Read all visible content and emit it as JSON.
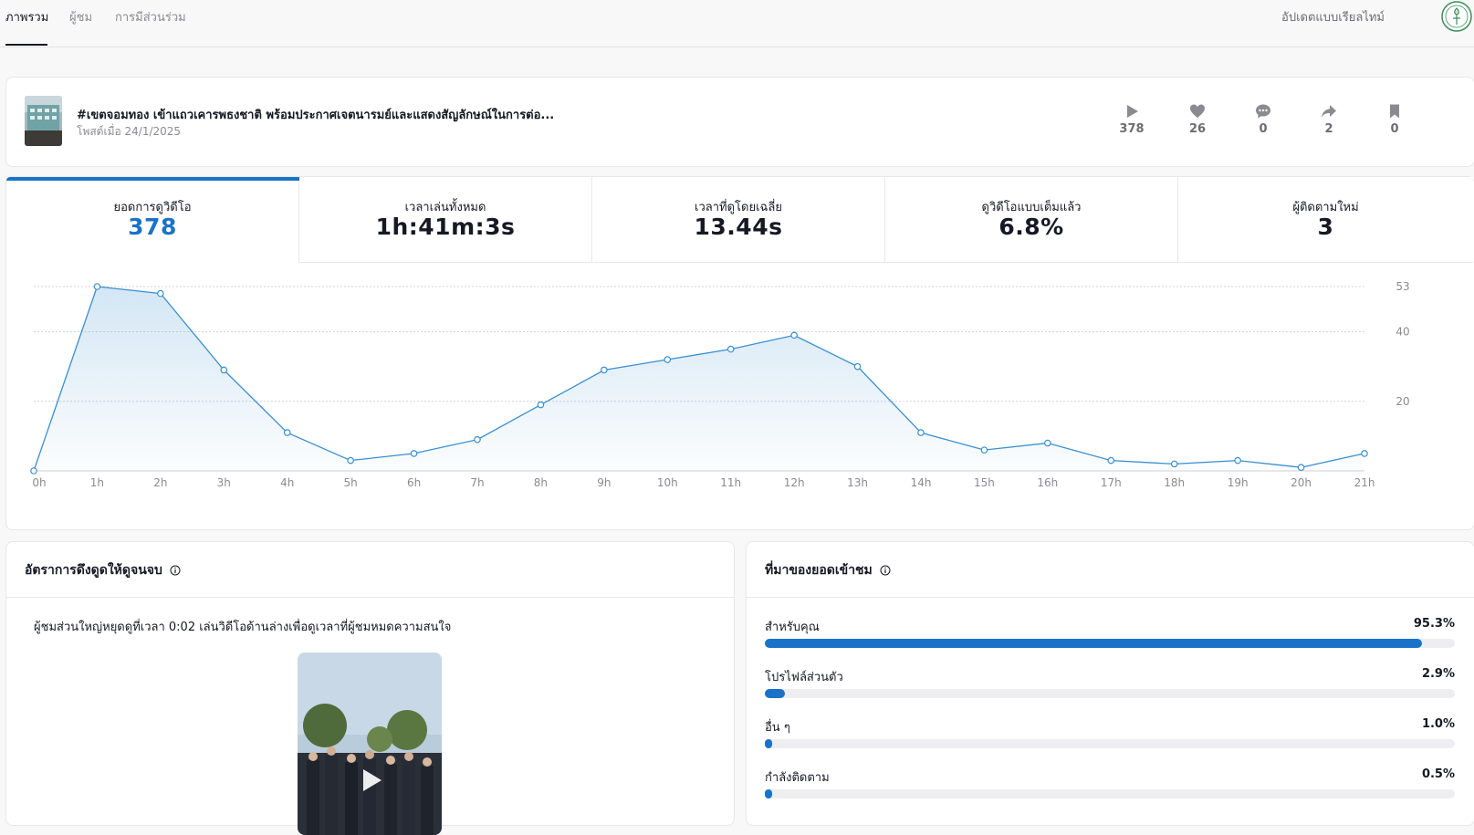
{
  "nav": {
    "tabs": [
      {
        "label": "ภาพรวม",
        "active": true
      },
      {
        "label": "ผู้ชม",
        "active": false
      },
      {
        "label": "การมีส่วนร่วม",
        "active": false
      }
    ],
    "realtime_label": "อัปเดตแบบเรียลไทม์"
  },
  "post": {
    "title": "#เขตจอมทอง เข้าแถวเคารพธงชาติ พร้อมประกาศเจตนารมย์และแสดงสัญลักษณ์ในการต่อ...",
    "date": "โพสต์เมื่อ 24/1/2025",
    "stats": {
      "views": {
        "icon": "play-icon",
        "value": "378"
      },
      "likes": {
        "icon": "heart-icon",
        "value": "26"
      },
      "comments": {
        "icon": "comment-icon",
        "value": "0"
      },
      "shares": {
        "icon": "share-icon",
        "value": "2"
      },
      "saves": {
        "icon": "bookmark-icon",
        "value": "0"
      }
    }
  },
  "metrics": [
    {
      "label": "ยอดการดูวิดีโอ",
      "value": "378",
      "active": true
    },
    {
      "label": "เวลาเล่นทั้งหมด",
      "value": "1h:41m:3s",
      "active": false
    },
    {
      "label": "เวลาที่ดูโดยเฉลี่ย",
      "value": "13.44s",
      "active": false
    },
    {
      "label": "ดูวิดีโอแบบเต็มแล้ว",
      "value": "6.8%",
      "active": false
    },
    {
      "label": "ผู้ติดตามใหม่",
      "value": "3",
      "active": false
    }
  ],
  "chart_data": {
    "type": "area",
    "x": [
      "0h",
      "1h",
      "2h",
      "3h",
      "4h",
      "5h",
      "6h",
      "7h",
      "8h",
      "9h",
      "10h",
      "11h",
      "12h",
      "13h",
      "14h",
      "15h",
      "16h",
      "17h",
      "18h",
      "19h",
      "20h",
      "21h"
    ],
    "values": [
      0,
      53,
      51,
      29,
      11,
      3,
      5,
      9,
      19,
      29,
      32,
      35,
      39,
      30,
      11,
      6,
      8,
      3,
      2,
      3,
      1,
      5
    ],
    "y_ticks": [
      "20",
      "40",
      "53"
    ],
    "ylim": [
      0,
      53
    ],
    "grid": true,
    "color": "#3a8fcf"
  },
  "retention": {
    "title": "อัตราการดึงดูดให้ดูจนจบ",
    "description": "ผู้ชมส่วนใหญ่หยุดดูที่เวลา 0:02 เล่นวิดีโอด้านล่างเพื่อดูเวลาที่ผู้ชมหมดความสนใจ"
  },
  "sources": {
    "title": "ที่มาของยอดเข้าชม",
    "items": [
      {
        "name": "สำหรับคุณ",
        "percent_label": "95.3%",
        "percent": 95.3
      },
      {
        "name": "โปรไฟล์ส่วนตัว",
        "percent_label": "2.9%",
        "percent": 2.9
      },
      {
        "name": "อื่น ๆ",
        "percent_label": "1.0%",
        "percent": 1.0
      },
      {
        "name": "กำลังติดตาม",
        "percent_label": "0.5%",
        "percent": 0.5
      }
    ]
  },
  "colors": {
    "accent": "#1a73c8",
    "line": "#3a8fcf",
    "muted": "#8a8b91"
  }
}
